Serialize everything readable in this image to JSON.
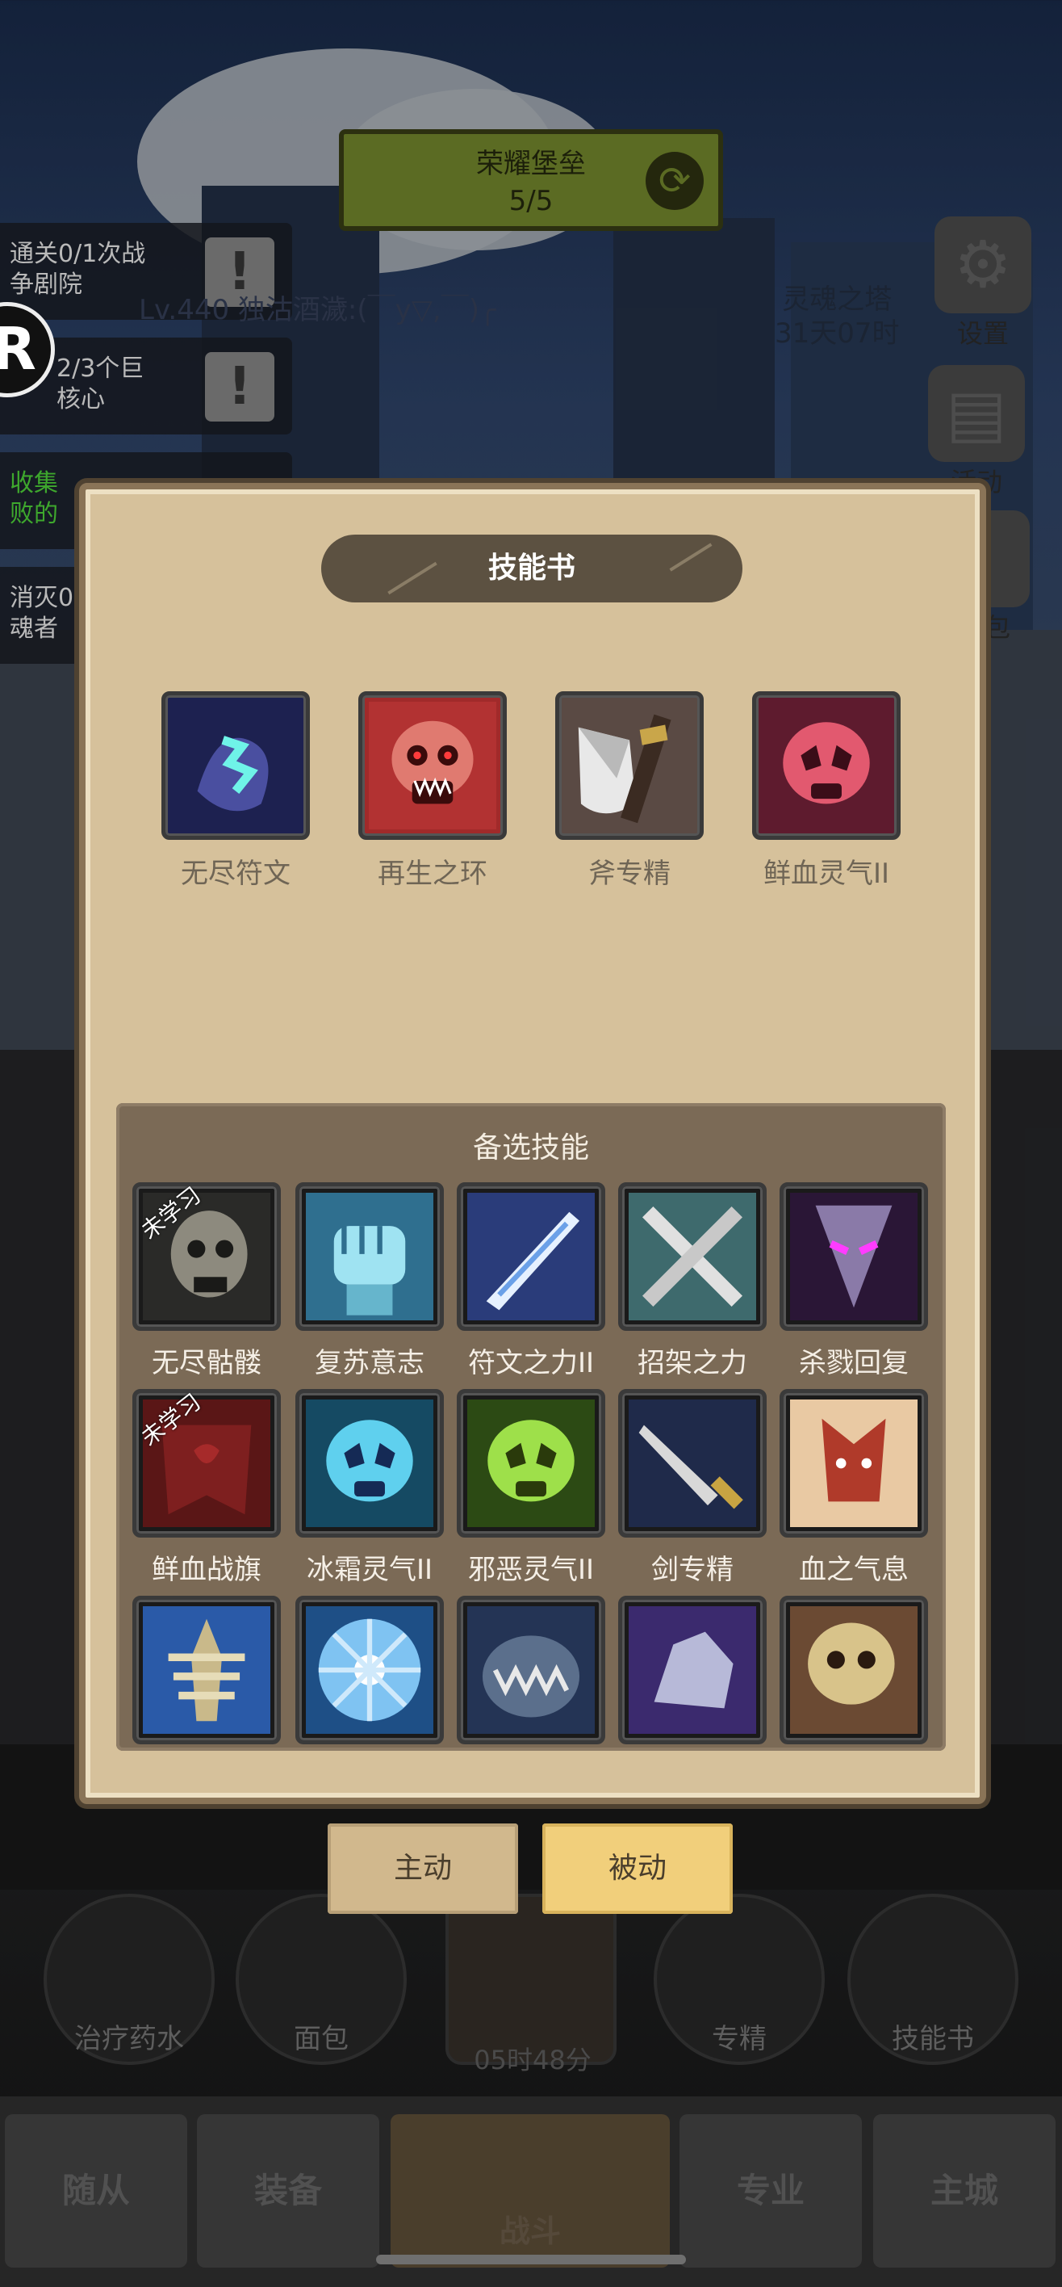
{
  "hud": {
    "castle_banner": {
      "title": "荣耀堡垒",
      "progress": "5/5"
    },
    "quests": [
      {
        "line1": "通关0/1次战",
        "line2": "争剧院"
      },
      {
        "line1": "2/3个巨",
        "line2": "核心"
      },
      {
        "line1": "收集",
        "line2": "败的"
      },
      {
        "line1": "消灭0",
        "line2": "魂者"
      }
    ],
    "player_name": "Lv.440 独沽酒濊:(￣y▽,￣)╭",
    "avatar_letter": "R",
    "tower": {
      "name": "灵魂之塔",
      "countdown": "31天07时"
    },
    "right_menu": [
      {
        "label": "设置",
        "icon": "gear-icon"
      },
      {
        "label": "活动",
        "icon": "scroll-icon"
      },
      {
        "label": "包",
        "icon": "coin-icon"
      }
    ],
    "quick_items": [
      {
        "label": "治疗药水",
        "icon": "potion-icon"
      },
      {
        "label": "面包",
        "icon": "bread-icon"
      },
      {
        "label": "",
        "icon": "chest-icon"
      },
      {
        "label": "专精",
        "icon": "mastery-icon"
      },
      {
        "label": "技能书",
        "icon": "book-icon"
      }
    ],
    "timer": "05时48分",
    "bottom_nav": [
      "随从",
      "装备",
      "战斗",
      "专业",
      "主城"
    ]
  },
  "dialog": {
    "title": "技能书",
    "equipped": [
      {
        "name": "无尽符文",
        "icon": "rune-icon"
      },
      {
        "name": "再生之环",
        "icon": "red-skull-icon"
      },
      {
        "name": "斧专精",
        "icon": "axe-icon"
      },
      {
        "name": "鲜血灵气II",
        "icon": "pink-skull-icon"
      }
    ],
    "pool_title": "备选技能",
    "unlearned_label": "未学习",
    "pool": [
      {
        "name": "无尽骷髅",
        "icon": "skeleton-icon",
        "unlearned": true
      },
      {
        "name": "复苏意志",
        "icon": "fist-icon",
        "unlearned": false
      },
      {
        "name": "符文之力II",
        "icon": "rune-blade-icon",
        "unlearned": false
      },
      {
        "name": "招架之力",
        "icon": "crossed-swords-icon",
        "unlearned": false
      },
      {
        "name": "杀戮回复",
        "icon": "demon-face-icon",
        "unlearned": false
      },
      {
        "name": "鲜血战旗",
        "icon": "blood-banner-icon",
        "unlearned": true
      },
      {
        "name": "冰霜灵气II",
        "icon": "frost-skull-icon",
        "unlearned": false
      },
      {
        "name": "邪恶灵气II",
        "icon": "green-skull-icon",
        "unlearned": false
      },
      {
        "name": "剑专精",
        "icon": "sword-icon",
        "unlearned": false
      },
      {
        "name": "血之气息",
        "icon": "blood-demon-icon",
        "unlearned": false
      },
      {
        "name": "",
        "icon": "bone-armor-icon",
        "unlearned": false
      },
      {
        "name": "",
        "icon": "frost-orb-icon",
        "unlearned": false
      },
      {
        "name": "",
        "icon": "maw-icon",
        "unlearned": false
      },
      {
        "name": "",
        "icon": "ice-rock-icon",
        "unlearned": false
      },
      {
        "name": "",
        "icon": "broken-skull-icon",
        "unlearned": false
      }
    ],
    "mode_tabs": [
      {
        "label": "主动",
        "active": false
      },
      {
        "label": "被动",
        "active": true
      }
    ]
  }
}
